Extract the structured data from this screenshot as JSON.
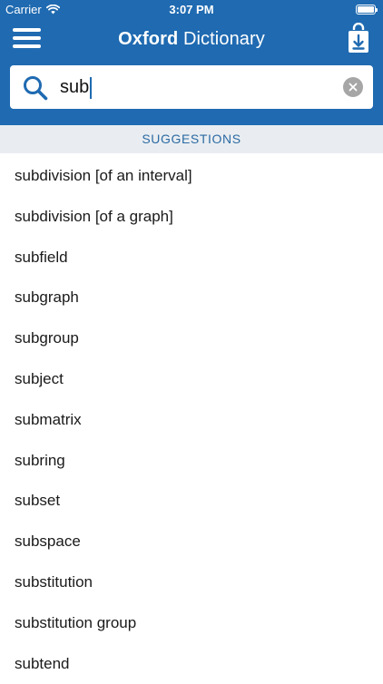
{
  "status_bar": {
    "carrier": "Carrier",
    "time": "3:07 PM",
    "wifi_icon": "wifi-icon",
    "battery_icon": "battery-icon"
  },
  "nav": {
    "title_bold": "Oxford",
    "title_rest": " Dictionary",
    "menu_icon": "hamburger-menu-icon",
    "download_icon": "download-bag-icon"
  },
  "search": {
    "value": "sub",
    "placeholder": "",
    "search_icon": "search-icon",
    "clear_icon": "clear-icon"
  },
  "suggestions": {
    "header": "SUGGESTIONS",
    "items": [
      "subdivision [of an interval]",
      "subdivision [of a graph]",
      "subfield",
      "subgraph",
      "subgroup",
      "subject",
      "submatrix",
      "subring",
      "subset",
      "subspace",
      "substitution",
      "substitution group",
      "subtend"
    ]
  },
  "colors": {
    "brand_blue": "#1f6ab1",
    "header_bg": "#e9edf1",
    "header_text": "#2c6aa3",
    "clear_gray": "#a6a6a6"
  }
}
